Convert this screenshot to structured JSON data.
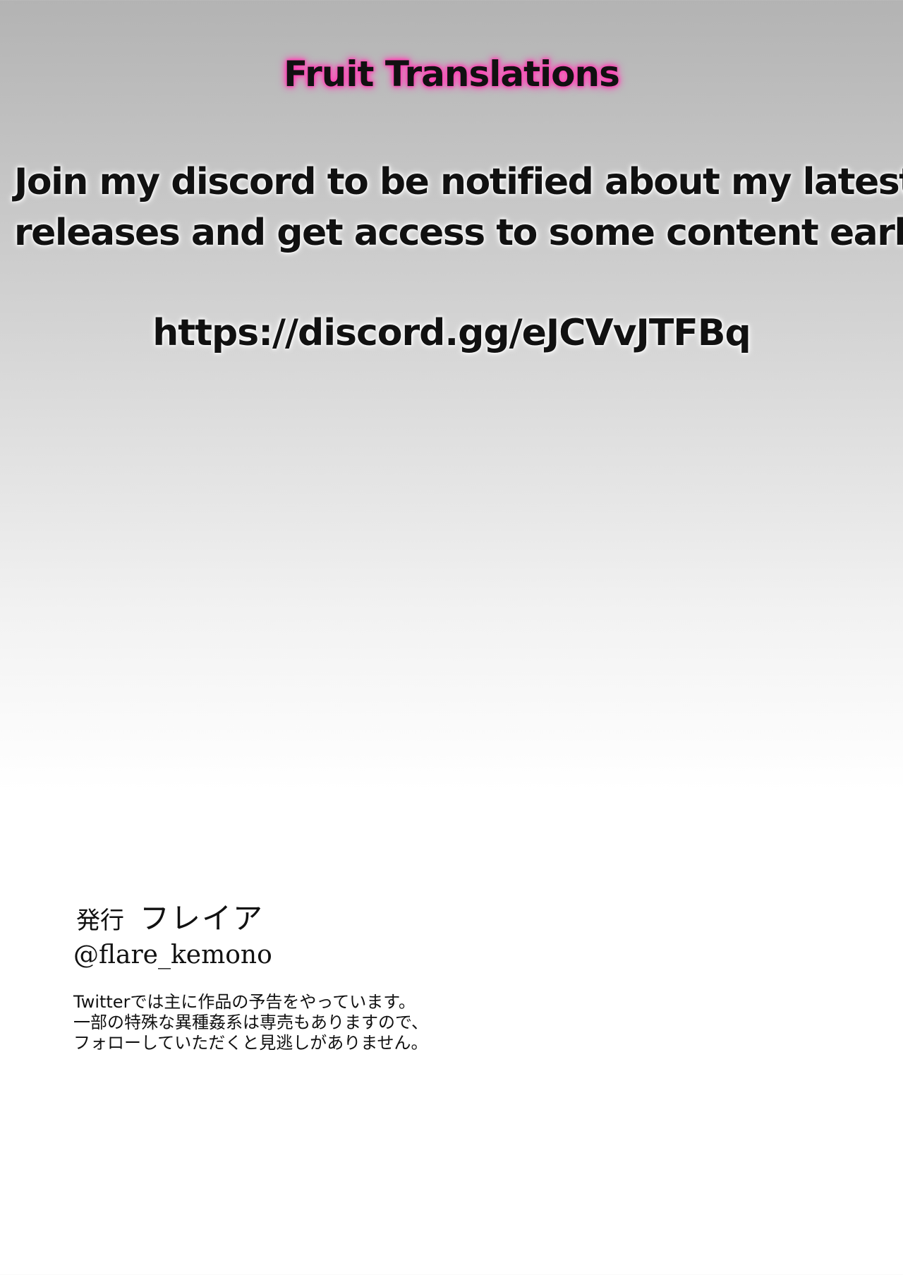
{
  "header": {
    "brand": "Fruit Translations"
  },
  "notice": {
    "line1": "Join my discord to be notified about my latest",
    "line2": "releases and get access to some content early",
    "link": "https://discord.gg/eJCVvJTFBq",
    "brand_glow_color": "#ff3fb4"
  },
  "credits": {
    "publisher_label": "発行",
    "publisher_name": "フレイア",
    "handle": "@flare_kemono",
    "description": [
      "Twitterでは主に作品の予告をやっています。",
      "一部の特殊な異種姦系は専売もありますので、",
      "フォローしていただくと見逃しがありません。"
    ]
  }
}
